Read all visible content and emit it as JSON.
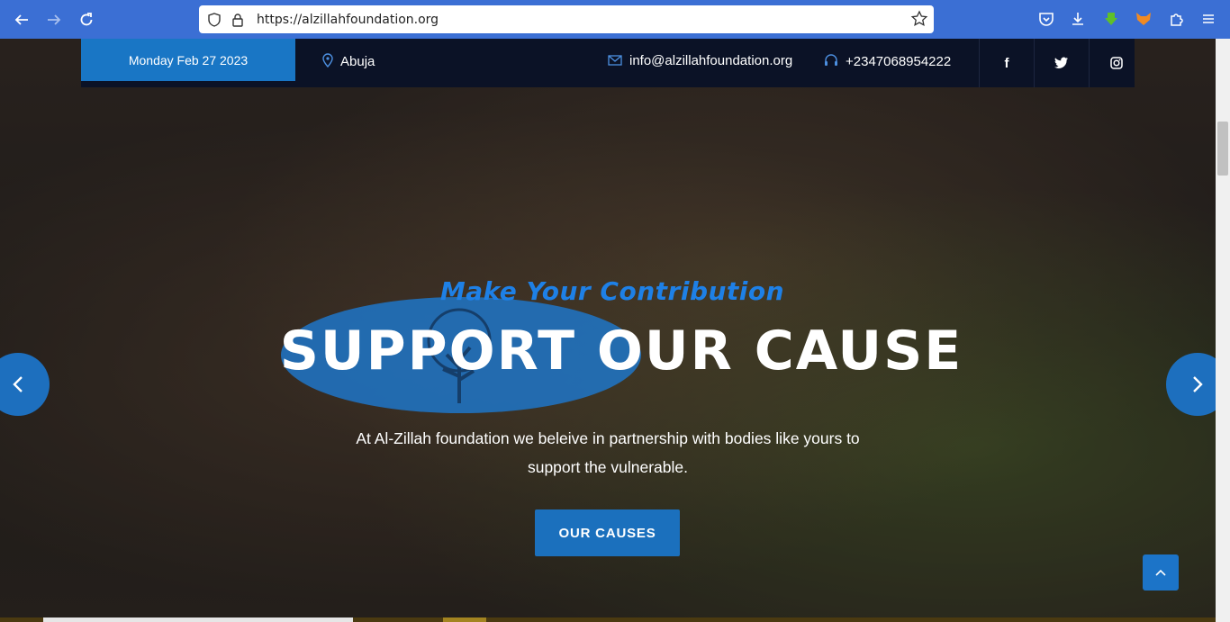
{
  "browser": {
    "url": "https://alzillahfoundation.org",
    "icons": [
      "back-icon",
      "forward-icon",
      "reload-icon",
      "shield-icon",
      "lock-icon",
      "star-icon",
      "pocket-icon",
      "download-icon",
      "extension-green-icon",
      "fox-icon",
      "puzzle-icon",
      "menu-icon"
    ]
  },
  "topbar": {
    "date": "Monday Feb 27 2023",
    "location": "Abuja",
    "email": "info@alzillahfoundation.org",
    "phone": "+2347068954222",
    "social": [
      "f",
      "twitter",
      "instagram"
    ]
  },
  "hero": {
    "subtitle": "Make Your Contribution",
    "title": "SUPPORT OUR CAUSE",
    "description_line1": "At Al-Zillah foundation we beleive in partnership with bodies like yours to",
    "description_line2": "support the vulnerable.",
    "cta_label": "OUR CAUSES"
  },
  "colors": {
    "accent": "#1976c5",
    "browser_bar": "#3b6fd4",
    "topbar_bg": "#0b1226",
    "subtitle": "#1e80e6"
  }
}
